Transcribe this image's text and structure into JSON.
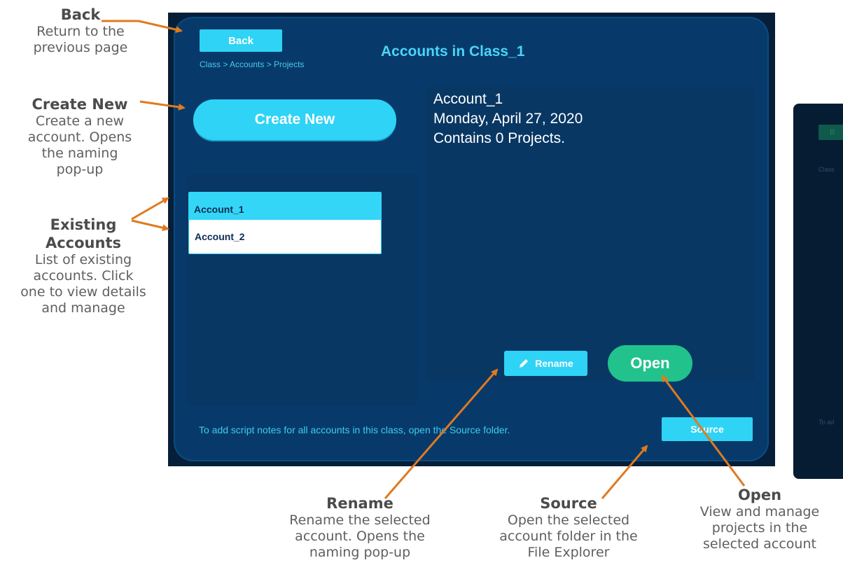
{
  "app": {
    "title": "Accounts in Class_1",
    "breadcrumb": "Class  >  Accounts  >  Projects",
    "back_label": "Back",
    "create_label": "Create New",
    "accounts": [
      {
        "label": "Account_1",
        "selected": true
      },
      {
        "label": "Account_2",
        "selected": false
      }
    ],
    "details": {
      "name": "Account_1",
      "date": "Monday, April 27, 2020",
      "projects": "Contains 0 Projects."
    },
    "rename_label": "Rename",
    "open_label": "Open",
    "footer_note": "To add script notes for all accounts in this class, open the Source folder.",
    "source_label": "Source"
  },
  "callouts": {
    "back": {
      "title": "Back",
      "desc": [
        "Return to the",
        "previous page"
      ]
    },
    "create": {
      "title": "Create New",
      "desc": [
        "Create a new",
        "account. Opens",
        "the naming",
        "pop-up"
      ]
    },
    "existing": {
      "title": [
        "Existing",
        "Accounts"
      ],
      "desc": [
        "List of existing",
        "accounts. Click",
        "one to view details",
        "and manage"
      ]
    },
    "rename": {
      "title": "Rename",
      "desc": [
        "Rename the selected",
        "account. Opens the",
        "naming pop-up"
      ]
    },
    "source": {
      "title": "Source",
      "desc": [
        "Open the selected",
        "account folder in the",
        "File Explorer"
      ]
    },
    "open": {
      "title": "Open",
      "desc": [
        "View and manage",
        "projects in the",
        "selected account"
      ]
    }
  },
  "second_screen": {
    "back_fragment": "B",
    "breadcrumb_fragment": "Class",
    "note_fragment": "To ad"
  },
  "colors": {
    "accent": "#2fd3f5",
    "open_green": "#22c28c",
    "panel_bg": "#073a6a",
    "outer_bg": "#071e38",
    "arrow": "#e07a1f"
  }
}
